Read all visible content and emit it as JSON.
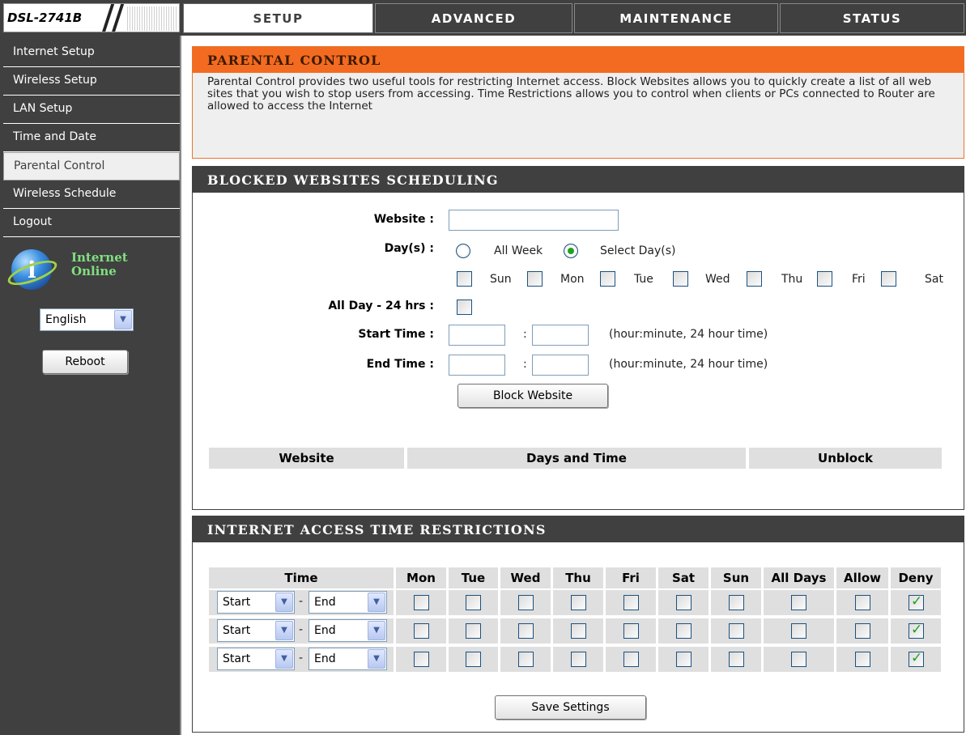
{
  "brand": {
    "model": "DSL-2741B"
  },
  "tabs": [
    {
      "label": "SETUP",
      "active": true
    },
    {
      "label": "ADVANCED",
      "active": false
    },
    {
      "label": "MAINTENANCE",
      "active": false
    },
    {
      "label": "STATUS",
      "active": false
    }
  ],
  "sidebar": {
    "items": [
      {
        "label": "Internet Setup",
        "active": false
      },
      {
        "label": "Wireless Setup",
        "active": false
      },
      {
        "label": "LAN Setup",
        "active": false
      },
      {
        "label": "Time and Date",
        "active": false
      },
      {
        "label": "Parental Control",
        "active": true
      },
      {
        "label": "Wireless Schedule",
        "active": false
      },
      {
        "label": "Logout",
        "active": false
      }
    ],
    "status_line1": "Internet",
    "status_line2": "Online",
    "language": "English",
    "reboot_label": "Reboot"
  },
  "parental": {
    "title": "PARENTAL CONTROL",
    "description": "Parental Control provides two useful tools for restricting Internet access. Block Websites allows you to quickly create a list of all web sites that you wish to stop users from accessing. Time Restrictions allows you to control when clients or PCs connected to Router are allowed to access the Internet"
  },
  "blocked": {
    "title": "BLOCKED WEBSITES SCHEDULING",
    "website_label": "Website :",
    "website_value": "",
    "days_label": "Day(s) :",
    "all_week_label": "All Week",
    "select_days_label": "Select Day(s)",
    "days_mode": "select",
    "days": [
      "Sun",
      "Mon",
      "Tue",
      "Wed",
      "Thu",
      "Fri",
      "Sat"
    ],
    "allday_label": "All Day - 24 hrs :",
    "start_label": "Start Time :",
    "end_label": "End Time :",
    "colon": ":",
    "time_hint": "(hour:minute, 24 hour time)",
    "block_button": "Block Website",
    "table_headers": [
      "Website",
      "Days and Time",
      "Unblock"
    ]
  },
  "restrictions": {
    "title": "INTERNET ACCESS TIME RESTRICTIONS",
    "headers": [
      "Time",
      "Mon",
      "Tue",
      "Wed",
      "Thu",
      "Fri",
      "Sat",
      "Sun",
      "All Days",
      "Allow",
      "Deny"
    ],
    "start_value": "Start",
    "dash": "-",
    "end_value": "End",
    "rows": [
      {
        "mon": false,
        "tue": false,
        "wed": false,
        "thu": false,
        "fri": false,
        "sat": false,
        "sun": false,
        "all_days": false,
        "allow": false,
        "deny": true
      },
      {
        "mon": false,
        "tue": false,
        "wed": false,
        "thu": false,
        "fri": false,
        "sat": false,
        "sun": false,
        "all_days": false,
        "allow": false,
        "deny": true
      },
      {
        "mon": false,
        "tue": false,
        "wed": false,
        "thu": false,
        "fri": false,
        "sat": false,
        "sun": false,
        "all_days": false,
        "allow": false,
        "deny": true
      }
    ],
    "save_button": "Save Settings"
  }
}
